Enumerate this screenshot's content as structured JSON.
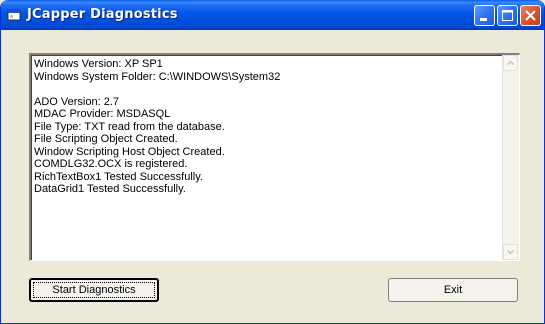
{
  "window": {
    "title": "JCapper Diagnostics",
    "controls": [
      "minimize",
      "maximize",
      "close"
    ]
  },
  "output": {
    "lines": [
      "Windows Version: XP SP1",
      "Windows System Folder: C:\\WINDOWS\\System32",
      "",
      "ADO Version: 2.7",
      "MDAC Provider: MSDASQL",
      "File Type: TXT read from the database.",
      "File Scripting Object Created.",
      "Window Scripting Host Object Created.",
      "COMDLG32.OCX is registered.",
      "RichTextBox1 Tested Successfully.",
      "DataGrid1 Tested Successfully."
    ]
  },
  "buttons": {
    "start_label": "Start Diagnostics",
    "exit_label": "Exit"
  },
  "colors": {
    "titlebar": "#0055e5",
    "window_bg": "#ece9d8",
    "close_button": "#d9532f"
  }
}
